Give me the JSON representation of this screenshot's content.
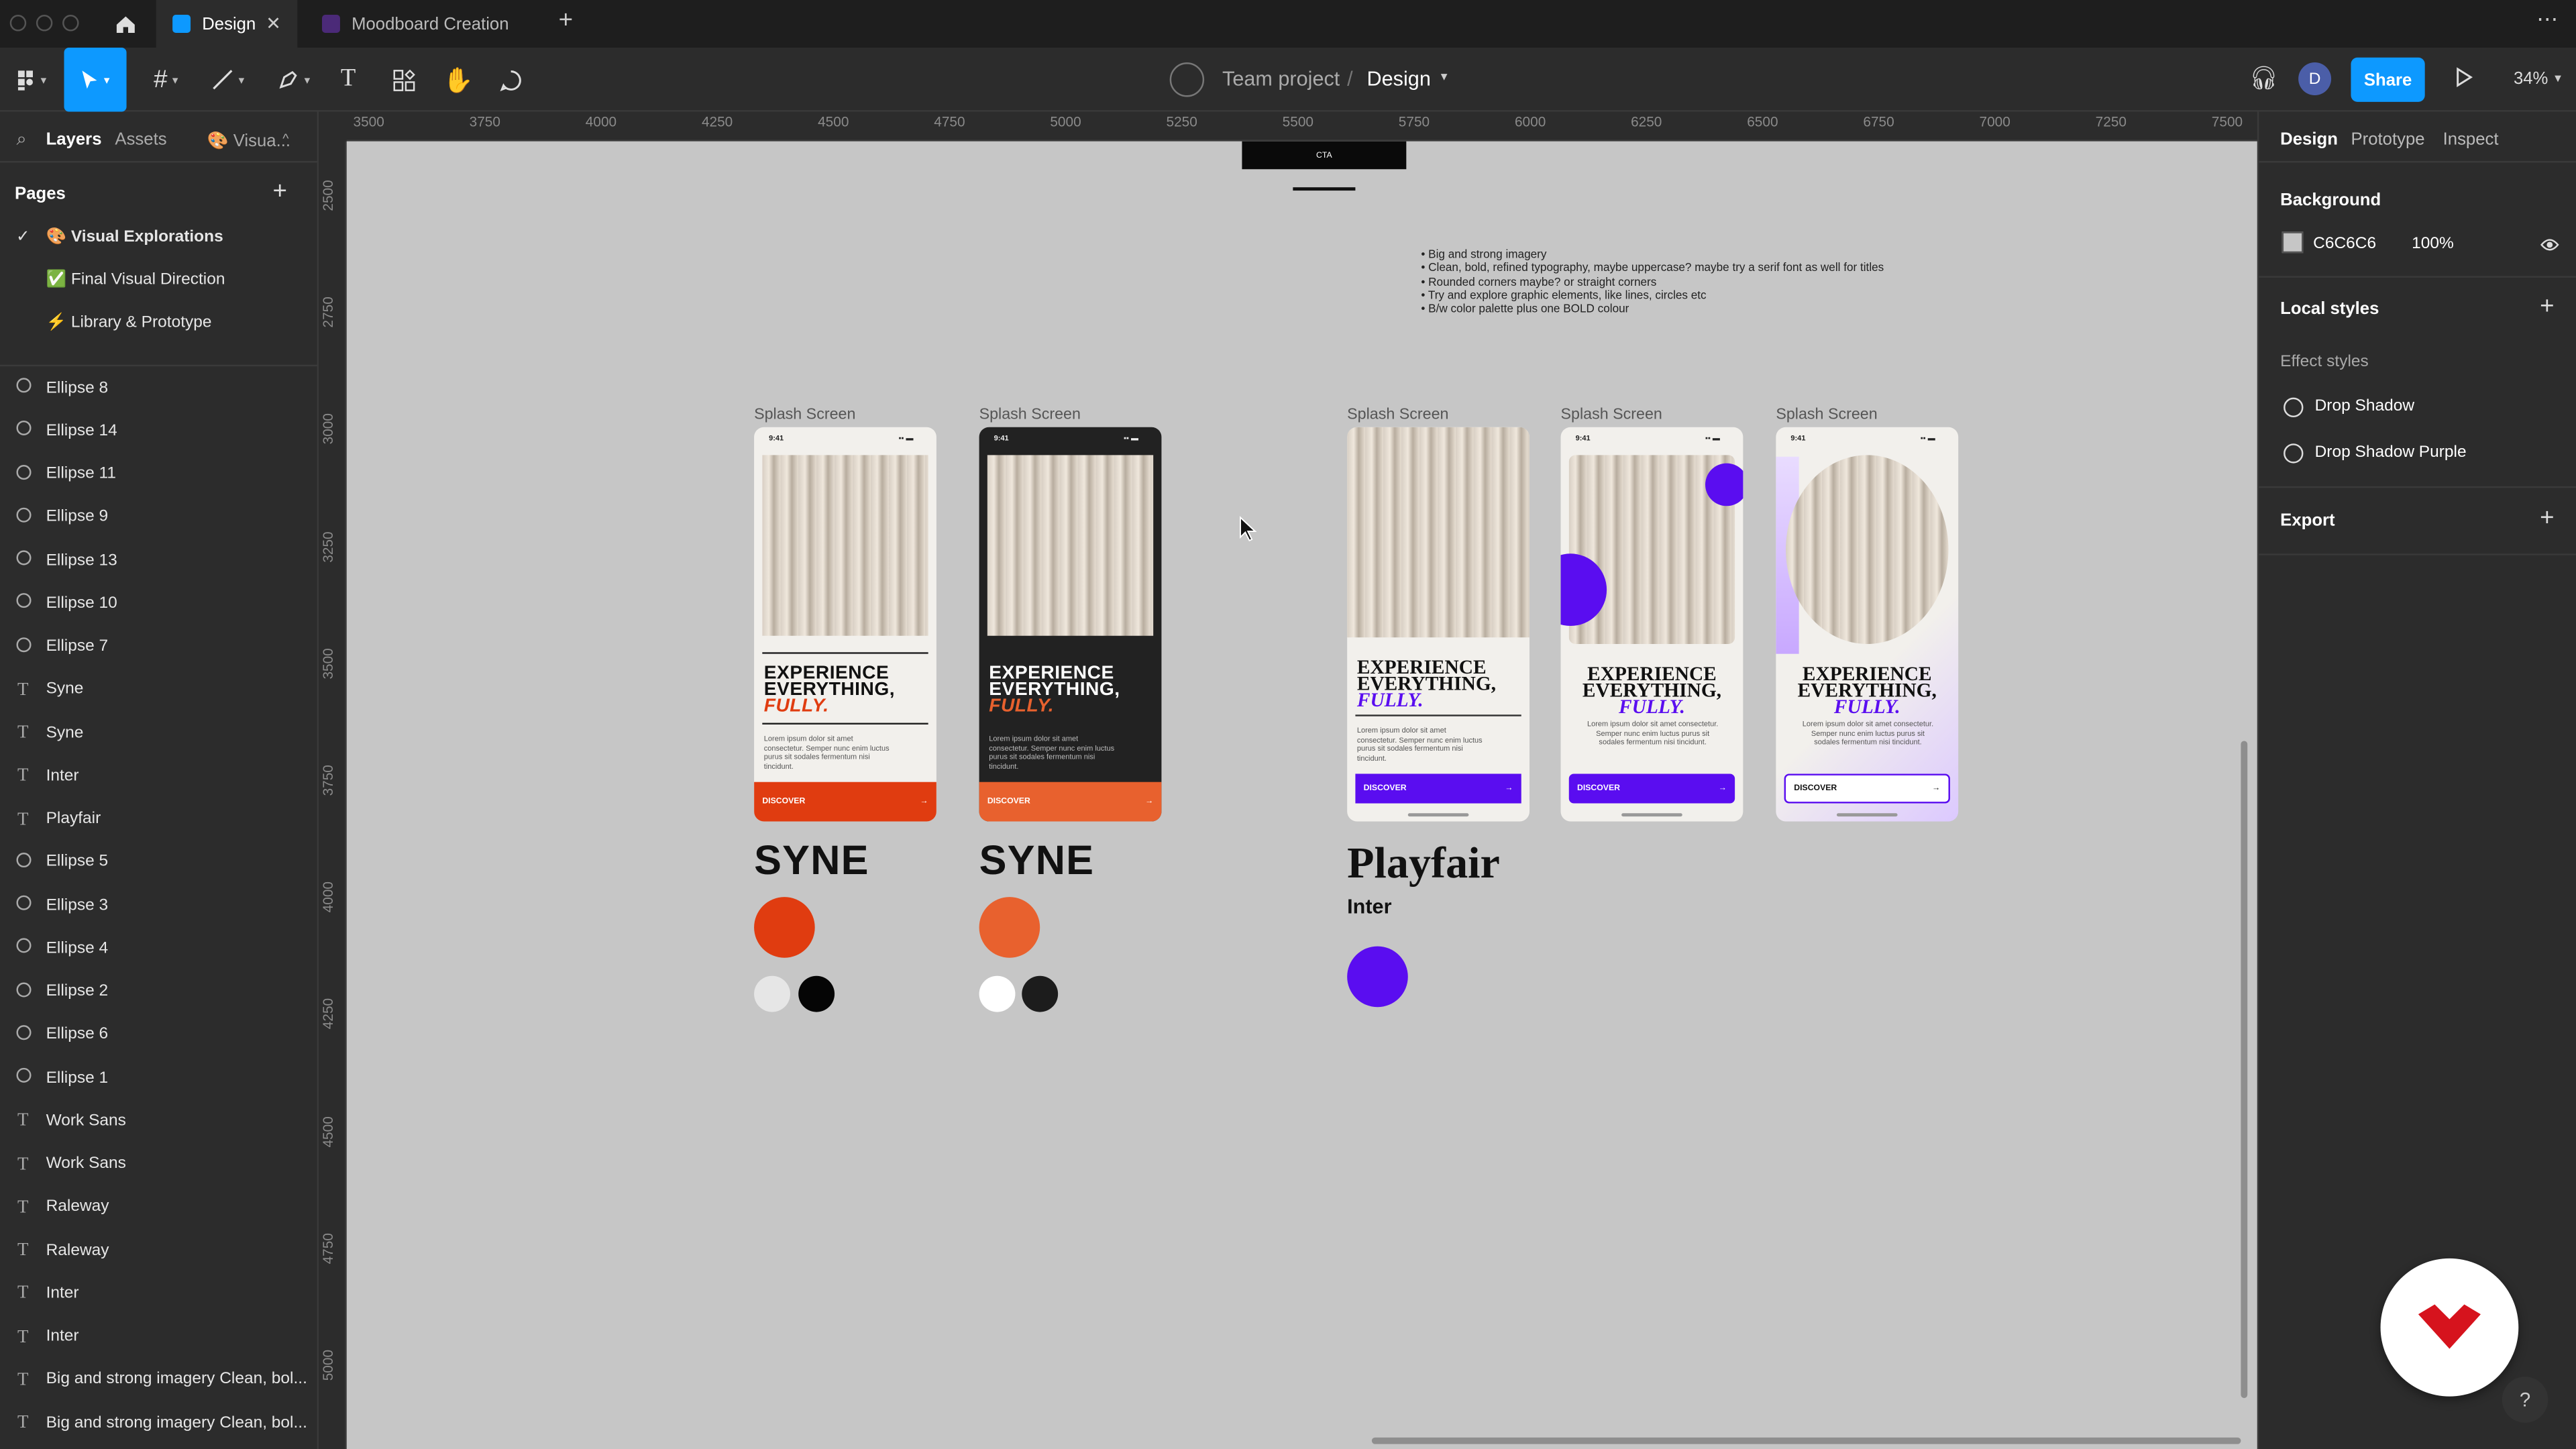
{
  "tabs": [
    {
      "label": "Design",
      "active": true
    },
    {
      "label": "Moodboard Creation",
      "active": false
    }
  ],
  "toolbar": {
    "project": "Team project",
    "separator": "/",
    "file": "Design",
    "avatar": "D",
    "share": "Share",
    "zoom": "34%"
  },
  "left": {
    "tabs": [
      "Layers",
      "Assets",
      "🎨 Visua..."
    ],
    "pages_title": "Pages",
    "pages": [
      {
        "label": "🎨 Visual Explorations",
        "current": true
      },
      {
        "label": "✅ Final Visual Direction",
        "current": false
      },
      {
        "label": "⚡ Library & Prototype",
        "current": false
      }
    ],
    "layers": [
      {
        "type": "ellipse",
        "label": "Ellipse 8"
      },
      {
        "type": "ellipse",
        "label": "Ellipse 14"
      },
      {
        "type": "ellipse",
        "label": "Ellipse 11"
      },
      {
        "type": "ellipse",
        "label": "Ellipse 9"
      },
      {
        "type": "ellipse",
        "label": "Ellipse 13"
      },
      {
        "type": "ellipse",
        "label": "Ellipse 10"
      },
      {
        "type": "ellipse",
        "label": "Ellipse 7"
      },
      {
        "type": "text",
        "label": "Syne"
      },
      {
        "type": "text",
        "label": "Syne"
      },
      {
        "type": "text",
        "label": "Inter"
      },
      {
        "type": "text",
        "label": "Playfair"
      },
      {
        "type": "ellipse",
        "label": "Ellipse 5"
      },
      {
        "type": "ellipse",
        "label": "Ellipse 3"
      },
      {
        "type": "ellipse",
        "label": "Ellipse 4"
      },
      {
        "type": "ellipse",
        "label": "Ellipse 2"
      },
      {
        "type": "ellipse",
        "label": "Ellipse 6"
      },
      {
        "type": "ellipse",
        "label": "Ellipse 1"
      },
      {
        "type": "text",
        "label": "Work Sans"
      },
      {
        "type": "text",
        "label": "Work Sans"
      },
      {
        "type": "text",
        "label": "Raleway"
      },
      {
        "type": "text",
        "label": "Raleway"
      },
      {
        "type": "text",
        "label": "Inter"
      },
      {
        "type": "text",
        "label": "Inter"
      },
      {
        "type": "text",
        "label": "Big and strong imagery Clean, bol..."
      },
      {
        "type": "text",
        "label": "Big and strong imagery Clean, bol..."
      }
    ]
  },
  "rulers": {
    "h": [
      "3500",
      "3750",
      "4000",
      "4250",
      "4500",
      "4750",
      "5000",
      "5250",
      "5500",
      "5750",
      "6000",
      "6250",
      "6500",
      "6750",
      "7000",
      "7250",
      "7500"
    ],
    "v": [
      "2500",
      "2750",
      "3000",
      "3250",
      "3500",
      "3750",
      "4000",
      "4250",
      "4500",
      "4750",
      "5000"
    ]
  },
  "right": {
    "tabs": [
      "Design",
      "Prototype",
      "Inspect"
    ],
    "background_title": "Background",
    "background_hex": "C6C6C6",
    "background_opacity": "100%",
    "local_styles": "Local styles",
    "effect_styles": "Effect styles",
    "effects": [
      "Drop Shadow",
      "Drop Shadow Purple"
    ],
    "export": "Export"
  },
  "canvas": {
    "cta": "CTA",
    "notes": [
      "Big and strong imagery",
      "Clean, bold, refined typography, maybe uppercase? maybe try a serif font as well for titles",
      "Rounded corners maybe? or straight corners",
      "Try and explore graphic elements, like lines, circles etc",
      "B/w color palette plus one BOLD colour"
    ],
    "frame_label": "Splash Screen",
    "time": "9:41",
    "headline1": "EXPERIENCE",
    "headline2": "EVERYTHING,",
    "headline3": "FULLY.",
    "lorem": "Lorem ipsum dolor sit amet consectetur. Semper nunc enim luctus purus sit sodales fermentum nisi tincidunt.",
    "discover": "DISCOVER",
    "arrow": "→",
    "font_syne": "SYNE",
    "font_playfair": "Playfair",
    "font_inter": "Inter",
    "colors": {
      "orange1": "#e03c10",
      "orange2": "#e8612e",
      "purple": "#5a0df0",
      "canvas_bg": "#c6c6c6",
      "accent_blue": "#0d99ff"
    }
  }
}
